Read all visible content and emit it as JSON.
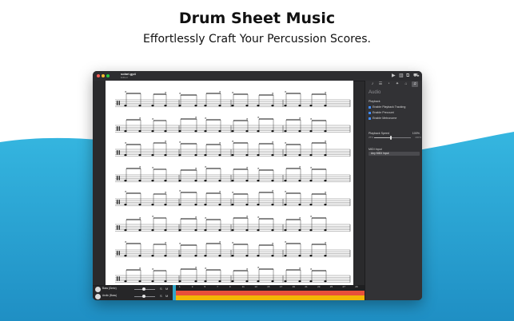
{
  "hero": {
    "title": "Drum Sheet Music",
    "subtitle": "Effortlessly Craft Your Percussion Scores."
  },
  "colors": {
    "wave_blue": "#2ba8d6",
    "playhead": "#2fa6c9",
    "track_red": "#e8503a",
    "track_yellow": "#f2b705",
    "checkbox_blue": "#3f8cff"
  },
  "window": {
    "file_name": "solari.gp4",
    "file_subtitle": "Edited",
    "toolbar_icons": [
      "play-icon",
      "library-icon",
      "export-icon",
      "cart-icon"
    ]
  },
  "inspector": {
    "tabs": [
      "note-icon",
      "track-icon",
      "tempo-icon",
      "effects-icon",
      "midi-icon",
      "audio-icon"
    ],
    "heading": "Audio",
    "playback_section": "Playback",
    "options": [
      {
        "label": "Enable Playback Tracking",
        "checked": true
      },
      {
        "label": "Enable Precount",
        "checked": true
      },
      {
        "label": "Enable Metronome",
        "checked": true
      }
    ],
    "playback_speed_label": "Playback Speed",
    "playback_speed_value": "100%",
    "speed_slider": {
      "min_label": "25%",
      "max_label": "200%",
      "value_fraction": 0.45
    },
    "midi_input_label": "MIDI Input",
    "midi_input_value": "Any MIDI Input"
  },
  "timeline": {
    "tracks": [
      {
        "name": "Bass (Gnrlz)",
        "ctrl_s": "S",
        "ctrl_m": "M"
      },
      {
        "name": "Arctic (Bass)",
        "ctrl_s": "S",
        "ctrl_m": "M"
      }
    ],
    "bar_numbers": [
      "1",
      "3",
      "5",
      "7",
      "9",
      "11",
      "13",
      "15",
      "17",
      "19",
      "21",
      "23",
      "25",
      "27",
      "29"
    ]
  }
}
